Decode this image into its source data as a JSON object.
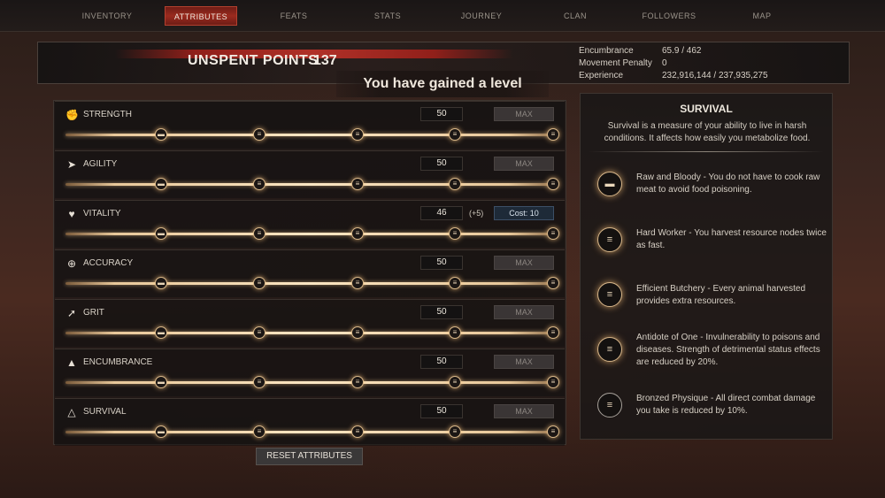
{
  "nav": {
    "tabs": [
      {
        "label": "INVENTORY"
      },
      {
        "label": "ATTRIBUTES"
      },
      {
        "label": "FEATS"
      },
      {
        "label": "STATS"
      },
      {
        "label": "JOURNEY"
      },
      {
        "label": "CLAN"
      },
      {
        "label": "FOLLOWERS"
      },
      {
        "label": "MAP"
      }
    ],
    "active": "ATTRIBUTES"
  },
  "header": {
    "unspent_label": "UNSPENT POINTS",
    "unspent_value": "137",
    "level_banner": "You have gained a level",
    "stats": [
      {
        "label": "Encumbrance",
        "value": "65.9 / 462"
      },
      {
        "label": "Movement Penalty",
        "value": "0"
      },
      {
        "label": "Experience",
        "value": "232,916,144 / 237,935,275"
      }
    ]
  },
  "attributes": [
    {
      "name": "STRENGTH",
      "icon": "strength-icon",
      "value": "50",
      "state": "MAX",
      "bonus": ""
    },
    {
      "name": "AGILITY",
      "icon": "agility-icon",
      "value": "50",
      "state": "MAX",
      "bonus": ""
    },
    {
      "name": "VITALITY",
      "icon": "heart-icon",
      "value": "46",
      "state": "Cost: 10",
      "bonus": "(+5)"
    },
    {
      "name": "ACCURACY",
      "icon": "crosshair-icon",
      "value": "50",
      "state": "MAX",
      "bonus": ""
    },
    {
      "name": "GRIT",
      "icon": "grit-icon",
      "value": "50",
      "state": "MAX",
      "bonus": ""
    },
    {
      "name": "ENCUMBRANCE",
      "icon": "weight-icon",
      "value": "50",
      "state": "MAX",
      "bonus": ""
    },
    {
      "name": "SURVIVAL",
      "icon": "campfire-icon",
      "value": "50",
      "state": "MAX",
      "bonus": ""
    }
  ],
  "reset_label": "RESET ATTRIBUTES",
  "detail": {
    "title": "SURVIVAL",
    "description": "Survival is a measure of your ability to live in harsh conditions. It affects how easily you metabolize food.",
    "perks": [
      {
        "text": "Raw and Bloody - You do not have to cook raw meat to avoid food poisoning.",
        "icon": "perk-tier-1-icon"
      },
      {
        "text": "Hard Worker - You harvest resource nodes twice as fast.",
        "icon": "perk-tier-2-icon"
      },
      {
        "text": "Efficient Butchery - Every animal harvested provides extra resources.",
        "icon": "perk-tier-3-icon"
      },
      {
        "text": "Antidote of One - Invulnerability to poisons and diseases. Strength of detrimental status effects are reduced by 20%.",
        "icon": "perk-tier-4-icon"
      },
      {
        "text": "Bronzed Physique - All direct combat damage you take is reduced by 10%.",
        "icon": "perk-tier-5-icon"
      }
    ]
  }
}
